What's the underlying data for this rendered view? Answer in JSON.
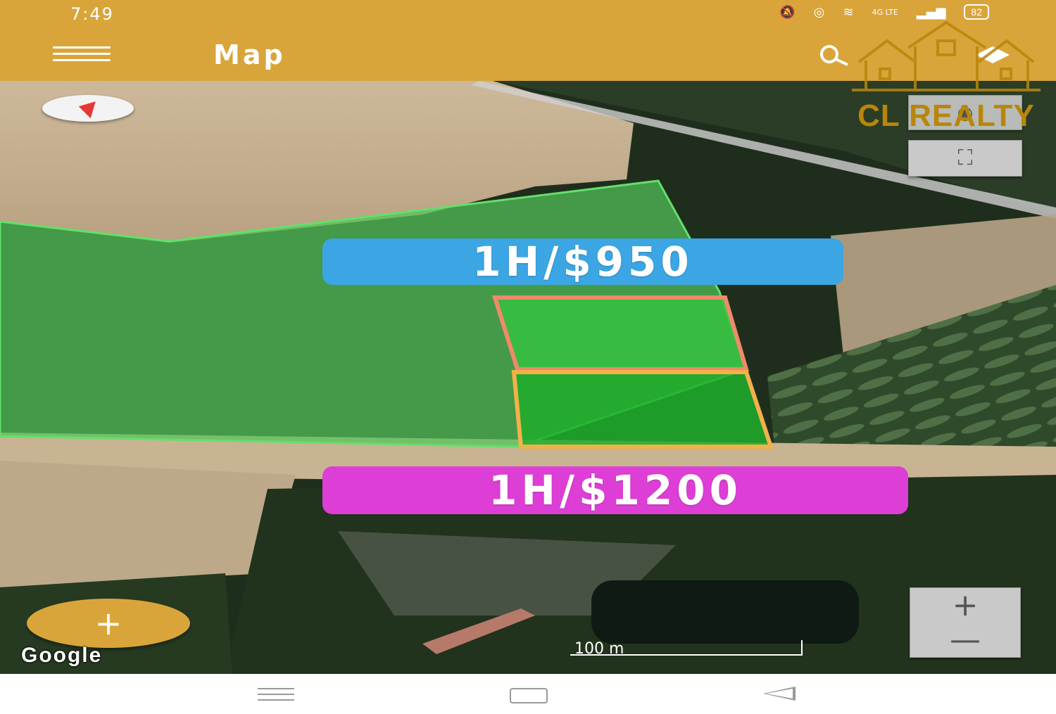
{
  "status_bar": {
    "time": "7:49",
    "battery": "82",
    "network": "4G LTE",
    "icons": [
      "alarm-icon",
      "location-icon",
      "wifi-icon",
      "lte-icon",
      "signal-icon",
      "battery-icon"
    ]
  },
  "app_bar": {
    "title": "Map",
    "menu_icon": "hamburger-menu-icon",
    "search_icon": "search-icon",
    "layers_icon": "layers-icon"
  },
  "map": {
    "price_tags": [
      {
        "label": "1H/$950",
        "color": "#3ba6e3"
      },
      {
        "label": "1H/$1200",
        "color": "#dd3fd6"
      }
    ],
    "attribution": "Google",
    "scale_label": "100 m",
    "fab_label": "+",
    "zoom_in_label": "+",
    "zoom_out_label": "—",
    "fullscreen_label": "⛶",
    "layers_label": "◉"
  },
  "watermark": {
    "text": "CL REALTY",
    "color": "#b8860b"
  },
  "nav_bar": {
    "icons": [
      "recents-icon",
      "home-icon",
      "back-icon"
    ]
  }
}
